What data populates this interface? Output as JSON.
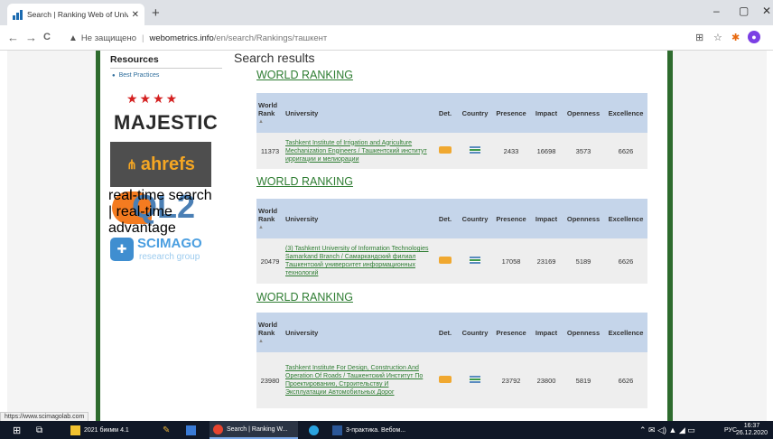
{
  "browser": {
    "tab_title": "Search | Ranking Web of Univers",
    "tab_close": "✕",
    "new_tab": "+",
    "window_controls": {
      "minimize": "–",
      "maximize": "▢",
      "close": "✕"
    },
    "nav": {
      "back": "←",
      "forward": "→",
      "reload": "C"
    },
    "address": {
      "not_secure": "Не защищено",
      "domain": "webometrics.info",
      "path": "/en/search/Rankings/ташкент"
    },
    "extension_icons": [
      "translate-icon",
      "star-icon",
      "puzzle-icon",
      "profile-icon"
    ]
  },
  "sidebar": {
    "resources_heading": "Resources",
    "best_practices": "Best Practices",
    "logos": {
      "majestic": "MAJESTIC",
      "ahrefs": "ahrefs",
      "ql2": "QL2",
      "ql2_sub": "real-time search | real-time advantage",
      "scimago": "SCIMAGO",
      "scimago_sub": "research group"
    }
  },
  "main": {
    "heading": "Search results",
    "section_title": "WORLD RANKING",
    "columns": [
      "World Rank",
      "University",
      "Det.",
      "Country",
      "Presence",
      "Impact",
      "Openness",
      "Excellence"
    ],
    "rows": [
      {
        "rank": "11373",
        "university": "Tashkent Institute of Irrigation and Agriculture Mechanization Engineers / Ташкентский институт ирригации и мелиорации",
        "presence": "2433",
        "impact": "16698",
        "openness": "3573",
        "excellence": "6626"
      },
      {
        "rank": "20479",
        "university": "(3) Tashkent University of Information Technologies Samarkand Branch / Самаркандский филиал Ташкентский университет информационных технологий",
        "presence": "17058",
        "impact": "23169",
        "openness": "5189",
        "excellence": "6626"
      },
      {
        "rank": "23980",
        "university": "Tashkent Institute For Design, Construction And Operation Of Roads / Ташкентский Институт По Проектированию, Строительству И Эксплуатации Автомобильных Дорог",
        "presence": "23792",
        "impact": "23800",
        "openness": "5819",
        "excellence": "6626"
      }
    ]
  },
  "status_url": "https://www.scimagolab.com",
  "taskbar": {
    "item1": "2021 бикмм 4.1",
    "item2": "Search | Ranking W...",
    "item3": "3-практика. Вебом...",
    "lang": "РУС",
    "time": "16:37",
    "date": "26.12.2020"
  },
  "colors": {
    "accent_green": "#2e7d32",
    "frame_green": "#2e6b2e",
    "table_header": "#c5d5ea"
  }
}
